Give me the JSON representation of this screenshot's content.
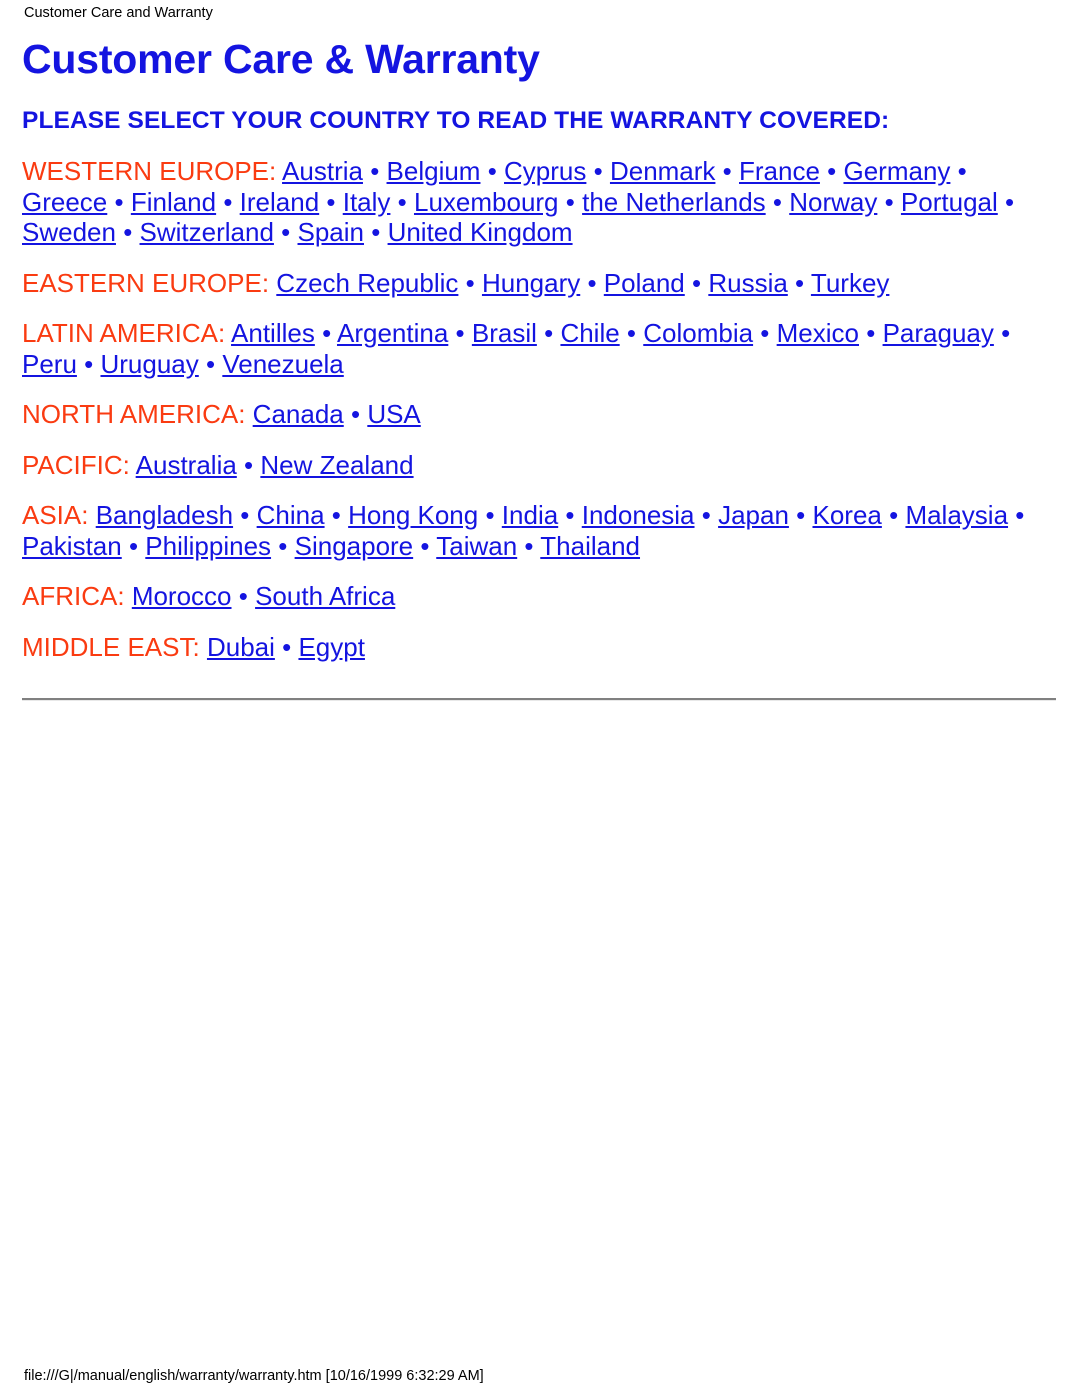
{
  "page": {
    "header_text": "Customer Care and Warranty",
    "footer_text": "file:///G|/manual/english/warranty/warranty.htm [10/16/1999 6:32:29 AM]",
    "title": "Customer Care & Warranty",
    "lead": "PLEASE SELECT YOUR COUNTRY TO READ THE WARRANTY COVERED:",
    "colors": {
      "title_blue": "#1414e0",
      "link_blue": "#1414e0",
      "region_label_orange": "#fa3b11",
      "text_black": "#000000",
      "background": "#ffffff",
      "rule_gray": "#808080"
    },
    "separator": "•"
  },
  "regions": [
    {
      "label": "WESTERN EUROPE:",
      "countries": [
        "Austria",
        "Belgium",
        "Cyprus",
        "Denmark",
        "France",
        "Germany",
        "Greece",
        "Finland",
        "Ireland",
        "Italy",
        "Luxembourg",
        "the Netherlands",
        "Norway",
        "Portugal",
        "Sweden",
        "Switzerland",
        "Spain",
        "United Kingdom"
      ]
    },
    {
      "label": "EASTERN EUROPE:",
      "countries": [
        "Czech Republic",
        "Hungary",
        "Poland",
        "Russia",
        "Turkey"
      ]
    },
    {
      "label": "LATIN AMERICA:",
      "countries": [
        "Antilles",
        "Argentina",
        "Brasil",
        "Chile",
        "Colombia",
        "Mexico",
        "Paraguay",
        "Peru",
        "Uruguay",
        "Venezuela"
      ]
    },
    {
      "label": "NORTH AMERICA:",
      "countries": [
        "Canada",
        "USA"
      ]
    },
    {
      "label": "PACIFIC:",
      "countries": [
        "Australia",
        "New Zealand"
      ]
    },
    {
      "label": "ASIA:",
      "countries": [
        "Bangladesh",
        "China",
        "Hong Kong",
        "India",
        "Indonesia",
        "Japan",
        "Korea",
        "Malaysia",
        "Pakistan",
        "Philippines",
        "Singapore",
        "Taiwan",
        "Thailand"
      ]
    },
    {
      "label": "AFRICA:",
      "countries": [
        "Morocco",
        "South Africa"
      ]
    },
    {
      "label": "MIDDLE EAST:",
      "countries": [
        "Dubai",
        "Egypt"
      ]
    }
  ]
}
